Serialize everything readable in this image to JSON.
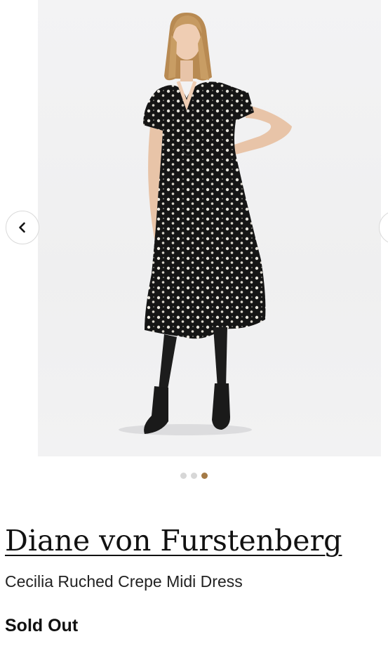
{
  "gallery": {
    "image_alt": "Model wearing black floral print midi dress with black tights and ankle boots",
    "prev_icon": "chevron-left-icon",
    "next_icon": "chevron-right-icon",
    "dots_count": 3,
    "active_dot": 3
  },
  "product": {
    "brand": "Diane von Furstenberg",
    "name": "Cecilia Ruched Crepe Midi Dress",
    "status": "Sold Out"
  },
  "colors": {
    "active_dot": "#a47a46",
    "inactive_dot": "#d7d7d7",
    "photo_bg": "#f1f1f2"
  }
}
